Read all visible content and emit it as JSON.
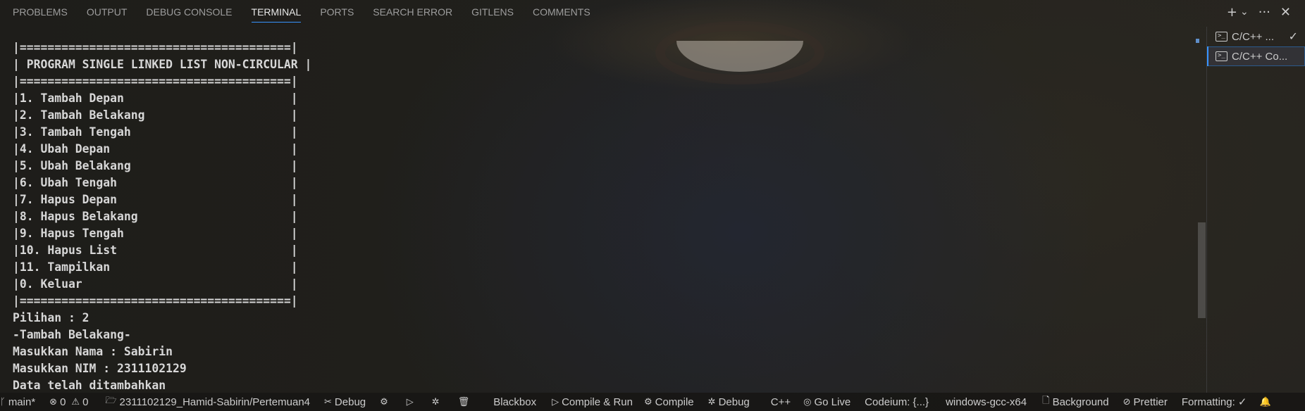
{
  "panel_tabs": [
    {
      "label": "PROBLEMS"
    },
    {
      "label": "OUTPUT"
    },
    {
      "label": "DEBUG CONSOLE"
    },
    {
      "label": "TERMINAL",
      "active": true
    },
    {
      "label": "PORTS"
    },
    {
      "label": "SEARCH ERROR"
    },
    {
      "label": "GITLENS"
    },
    {
      "label": "COMMENTS"
    }
  ],
  "panel_actions": {
    "new_terminal": "+",
    "dropdown": "⌄",
    "more": "···",
    "close": "✕"
  },
  "terminal": {
    "lines": [
      "|=======================================|",
      "| PROGRAM SINGLE LINKED LIST NON-CIRCULAR |",
      "|=======================================|",
      "|1. Tambah Depan                        |",
      "|2. Tambah Belakang                     |",
      "|3. Tambah Tengah                       |",
      "|4. Ubah Depan                          |",
      "|5. Ubah Belakang                       |",
      "|6. Ubah Tengah                         |",
      "|7. Hapus Depan                         |",
      "|8. Hapus Belakang                      |",
      "|9. Hapus Tengah                        |",
      "|10. Hapus List                         |",
      "|11. Tampilkan                          |",
      "|0. Keluar                              |",
      "|=======================================|",
      "Pilihan : 2",
      "-Tambah Belakang-",
      "Masukkan Nama : Sabirin",
      "Masukkan NIM : 2311102129",
      "Data telah ditambahkan"
    ]
  },
  "terminal_list": [
    {
      "label": "C/C++ ...",
      "icon": "terminal-icon",
      "check": "✓"
    },
    {
      "label": "C/C++ Co...",
      "icon": "terminal-icon",
      "selected": true
    }
  ],
  "status_bar": {
    "branch": "main*",
    "errors": "0",
    "warnings": "0",
    "folder": "2311102129_Hamid-Sabirin/Pertemuan4",
    "debug": "Debug",
    "blackbox": "Blackbox",
    "compile_run": "Compile & Run",
    "compile": "Compile",
    "debug2": "Debug",
    "language": "C++",
    "go_live": "Go Live",
    "codeium": "Codeium: {...}",
    "compiler": "windows-gcc-x64",
    "background": "Background",
    "prettier": "Prettier",
    "formatting": "Formatting: ✓"
  }
}
